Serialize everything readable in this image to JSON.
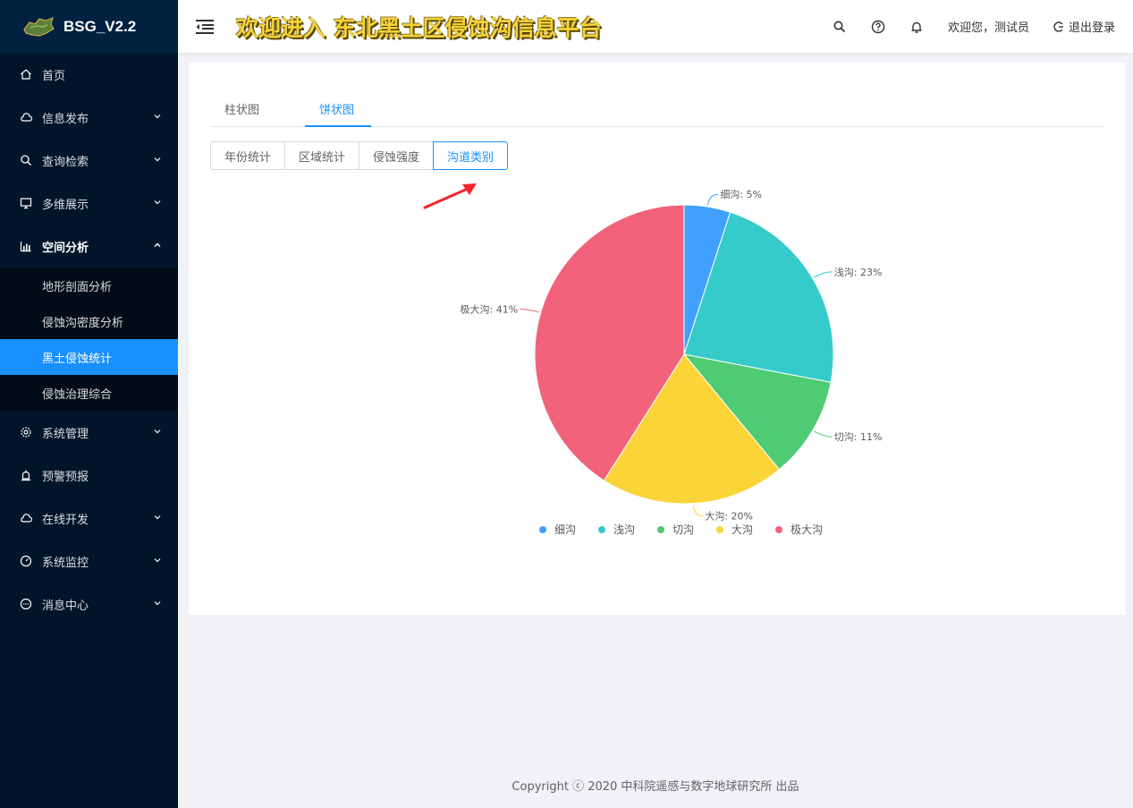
{
  "app": {
    "name": "BSG_V2.2",
    "banner": "欢迎进入 东北黑土区侵蚀沟信息平台"
  },
  "sidebar": {
    "items": [
      {
        "label": "首页",
        "icon": "home-icon"
      },
      {
        "label": "信息发布",
        "icon": "cloud-icon"
      },
      {
        "label": "查询检索",
        "icon": "search-icon"
      },
      {
        "label": "多维展示",
        "icon": "monitor-icon"
      },
      {
        "label": "空间分析",
        "icon": "bar-chart-icon"
      },
      {
        "label": "系统管理",
        "icon": "gear-icon"
      },
      {
        "label": "预警预报",
        "icon": "alarm-icon"
      },
      {
        "label": "在线开发",
        "icon": "cloud-icon"
      },
      {
        "label": "系统监控",
        "icon": "dashboard-icon"
      },
      {
        "label": "消息中心",
        "icon": "chat-icon"
      }
    ],
    "sub_items": [
      "地形剖面分析",
      "侵蚀沟密度分析",
      "黑土侵蚀统计",
      "侵蚀治理综合"
    ],
    "active_sub": "黑土侵蚀统计"
  },
  "header": {
    "welcome": "欢迎您，测试员",
    "logout": "退出登录"
  },
  "tabs": [
    "柱状图",
    "饼状图"
  ],
  "active_tab": "饼状图",
  "buttons": [
    "年份统计",
    "区域统计",
    "侵蚀强度",
    "沟道类别"
  ],
  "active_button": "沟道类别",
  "colors": {
    "accent": "#1890ff",
    "sidebar": "#001529",
    "arrow": "#f5222d"
  },
  "chart_data": {
    "type": "pie",
    "categories": [
      "细沟",
      "浅沟",
      "切沟",
      "大沟",
      "极大沟"
    ],
    "values": [
      5,
      23,
      11,
      20,
      41
    ],
    "labels": [
      "细沟: 5%",
      "浅沟: 23%",
      "切沟: 11%",
      "大沟: 20%",
      "极大沟: 41%"
    ],
    "colors": [
      "#3fa0fd",
      "#36cbcb",
      "#4ecb73",
      "#fbd437",
      "#f2637b"
    ],
    "legend": "bottom"
  },
  "footer": "Copyright ⓒ 2020 中科院遥感与数字地球研究所 出品"
}
